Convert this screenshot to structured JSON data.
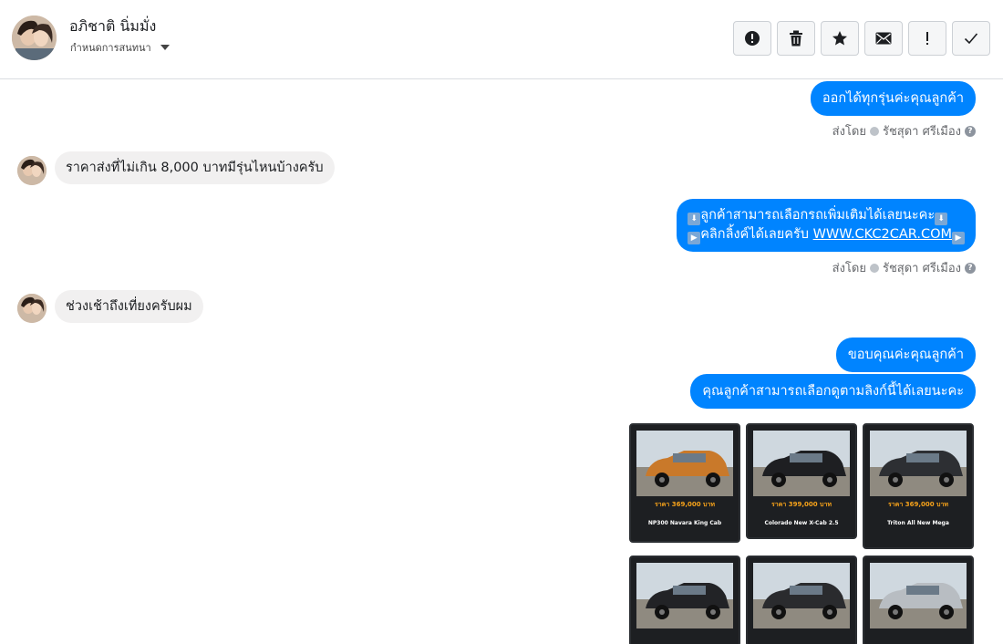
{
  "header": {
    "contact_name": "อภิชาติ นิ่มมั่ง",
    "assign_label": "กำหนดการสนทนา",
    "actions": [
      {
        "name": "mark-spam-button",
        "icon": "alert-circle-icon"
      },
      {
        "name": "delete-button",
        "icon": "trash-icon"
      },
      {
        "name": "star-button",
        "icon": "star-icon"
      },
      {
        "name": "mark-unread-button",
        "icon": "envelope-icon"
      },
      {
        "name": "follow-up-button",
        "icon": "exclamation-icon"
      },
      {
        "name": "mark-done-button",
        "icon": "checkmark-icon"
      }
    ]
  },
  "messages": [
    {
      "dir": "out",
      "text": "ออกได้ทุกรุ่นค่ะคุณลูกค้า"
    },
    {
      "dir": "meta",
      "sent_by_label": "ส่งโดย",
      "sender": "รัชสุดา ศรีเมือง"
    },
    {
      "dir": "in",
      "text": "ราคาส่งที่ไม่เกิน 8,000 บาทมีรุ่นไหนบ้างครับ"
    },
    {
      "dir": "out",
      "line1": "ลูกค้าสามารถเลือกรถเพิ่มเติมได้เลยนะคะ",
      "line2_prefix": "คลิกลิ้งค์ได้เลยครับ ",
      "link": "WWW.CKC2CAR.COM"
    },
    {
      "dir": "meta",
      "sent_by_label": "ส่งโดย",
      "sender": "รัชสุดา ศรีเมือง"
    },
    {
      "dir": "in",
      "text": "ช่วงเช้าถึงเที่ยงครับผม"
    },
    {
      "dir": "out",
      "text": "ขอบคุณค่ะคุณลูกค้า"
    },
    {
      "dir": "out",
      "text": "คุณลูกค้าสามารถเลือกดูตามลิงก์นี้ได้เลยนะคะ"
    }
  ],
  "cars": [
    {
      "price": "ราคา 369,000 บาท",
      "model": "NP300 Navara King Cab",
      "body": "#c9792a"
    },
    {
      "price": "ราคา 399,000 บาท",
      "model": "Colorado New X-Cab 2.5",
      "body": "#1e1f22"
    },
    {
      "price": "ราคา 369,000 บาท",
      "model": "Triton All New Mega",
      "body": "#2d2f33"
    },
    {
      "price": "",
      "model": "",
      "body": "#222326"
    },
    {
      "price": "",
      "model": "",
      "body": "#2a2b2e"
    },
    {
      "price": "",
      "model": "",
      "body": "#b8bdc2"
    }
  ],
  "colors": {
    "accent": "#0084ff",
    "incoming": "#f1f0f0"
  }
}
